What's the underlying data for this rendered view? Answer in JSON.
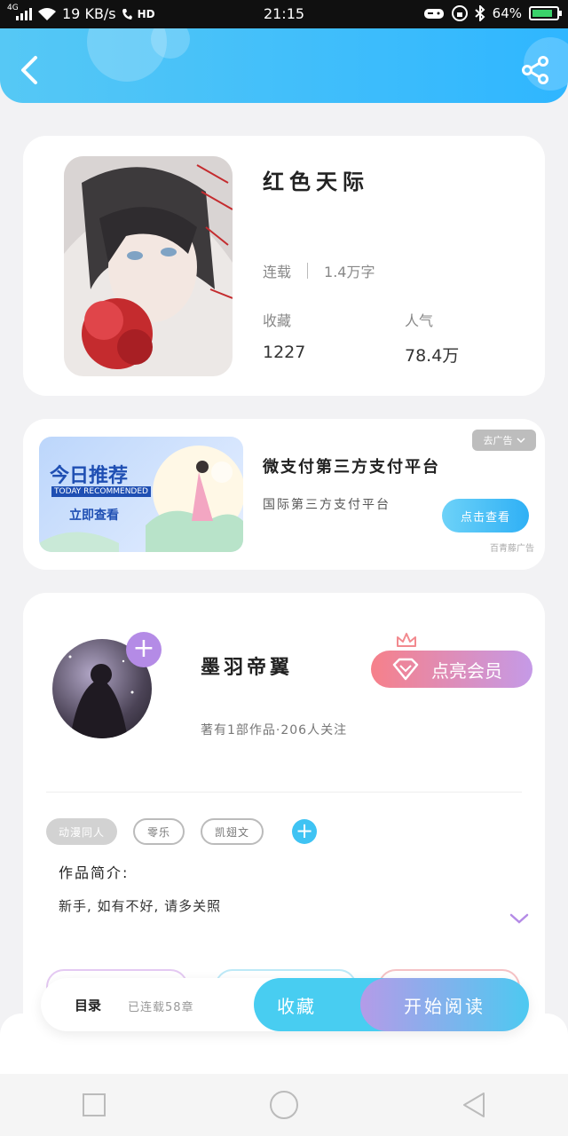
{
  "status_bar": {
    "network": "4G",
    "speed": "19 KB/s",
    "hd": "HD",
    "time": "21:15",
    "battery": "64%"
  },
  "book": {
    "title": "红色天际",
    "status": "连载",
    "word_count": "1.4万字",
    "favorites_label": "收藏",
    "favorites_value": "1227",
    "popularity_label": "人气",
    "popularity_value": "78.4万"
  },
  "ad": {
    "image_title": "今日推荐",
    "image_subtitle": "TODAY RECOMMENDED",
    "image_cta": "立即查看",
    "title": "微支付第三方支付平台",
    "subtitle": "国际第三方支付平台",
    "close_label": "去广告",
    "button_label": "点击查看",
    "source": "百青藤广告"
  },
  "author": {
    "name": "墨羽帝翼",
    "info": "著有1部作品·206人关注",
    "vip_label": "点亮会员",
    "tags": [
      "动漫同人",
      "零乐",
      "凯翅文"
    ],
    "intro_label": "作品简介:",
    "intro_text": "新手, 如有不好, 请多关照"
  },
  "bottom_bar": {
    "toc_label": "目录",
    "chapter_count": "已连载58章",
    "favorite_label": "收藏",
    "read_label": "开始阅读"
  },
  "colors": {
    "header": "#2fb6ff",
    "accent_blue": "#48cdf1",
    "vip_pink": "#f6808a",
    "vip_purple": "#c59ae7",
    "plus_purple": "#b48be6"
  }
}
